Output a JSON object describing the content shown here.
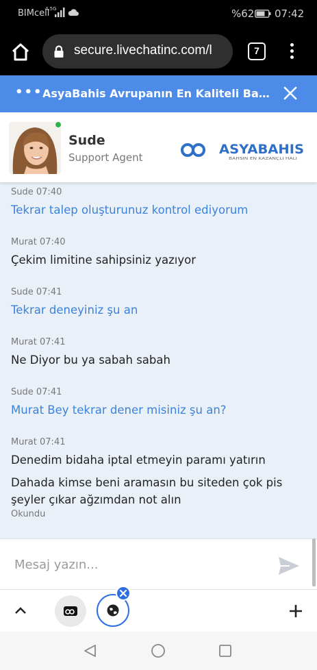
{
  "status_bar": {
    "carrier": "BIMcell",
    "network_small": "4.5G",
    "battery_percent": "%62",
    "time": "07:42"
  },
  "browser": {
    "url": "secure.livechatinc.com/l",
    "tab_count": "7",
    "icons": [
      "home-icon",
      "lock-icon",
      "tabs-icon",
      "menu-icon"
    ]
  },
  "chat_header": {
    "title": "AsyaBahis Avrupanın En Kaliteli Ba..."
  },
  "agent": {
    "name": "Sude",
    "role": "Support Agent",
    "online_color": "#2fb24c",
    "brand_name": "ASYABAHIS",
    "brand_tagline": "BAHSIN EN KAZANÇLI HALI"
  },
  "messages": [
    {
      "author": "Sude",
      "time": "07:40",
      "text": "Tekrar talep oluşturunuz kontrol ediyorum",
      "from_agent": true
    },
    {
      "author": "Murat",
      "time": "07:40",
      "text": "Çekim limitine sahipsiniz yazıyor",
      "from_agent": false
    },
    {
      "author": "Sude",
      "time": "07:41",
      "text": "Tekrar deneyiniz şu an",
      "from_agent": true
    },
    {
      "author": "Murat",
      "time": "07:41",
      "text": "Ne Diyor bu ya sabah sabah",
      "from_agent": false
    },
    {
      "author": "Sude",
      "time": "07:41",
      "text": "Murat Bey tekrar dener misiniz şu an?",
      "from_agent": true
    },
    {
      "author": "Murat",
      "time": "07:41",
      "text": "Denedim bidaha iptal etmeyin paramı yatırın",
      "from_agent": false
    },
    {
      "text": "Dahada kimse beni aramasın bu siteden çok pis şeyler çıkar ağzımdan not alın",
      "from_agent": false,
      "receipt": "Okundu"
    }
  ],
  "composer": {
    "placeholder": "Mesaj yazın..."
  },
  "colors": {
    "accent": "#4d8be8",
    "agent_text": "#3b82dc",
    "background": "#eaf0f8"
  }
}
